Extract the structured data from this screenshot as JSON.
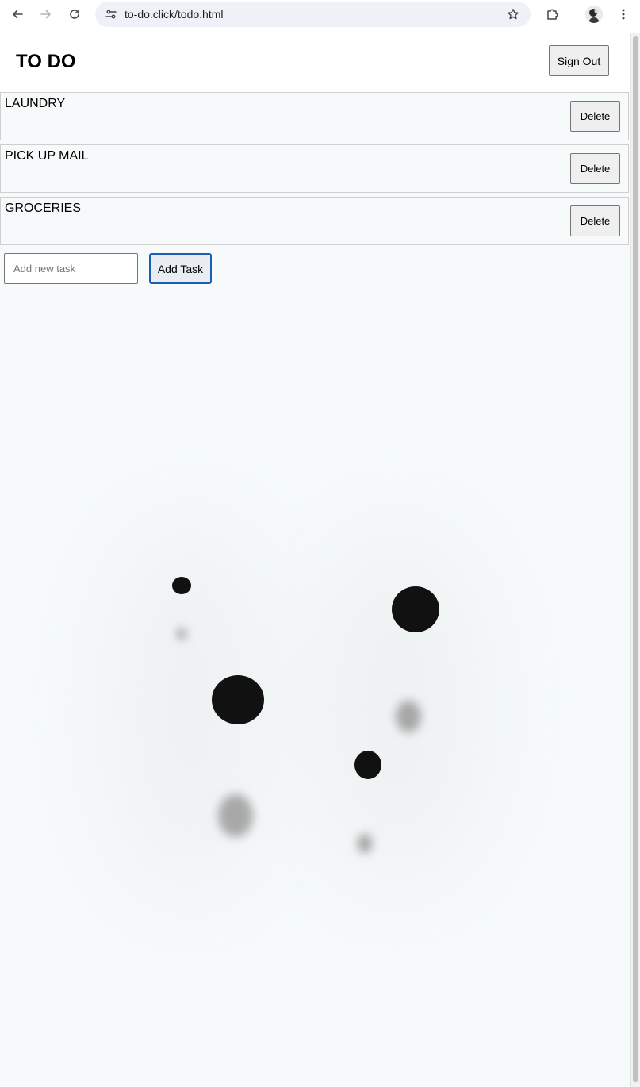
{
  "browser": {
    "url": "to-do.click/todo.html",
    "icons": {
      "back": "arrow-left-icon",
      "forward": "arrow-right-icon",
      "reload": "reload-icon",
      "site_info": "tune-icon",
      "bookmark": "star-icon",
      "extensions": "puzzle-icon",
      "profile": "avatar",
      "menu": "kebab-menu-icon"
    }
  },
  "app": {
    "title": "TO DO",
    "sign_out_label": "Sign Out",
    "tasks": [
      {
        "text": "LAUNDRY",
        "delete_label": "Delete"
      },
      {
        "text": "PICK UP MAIL",
        "delete_label": "Delete"
      },
      {
        "text": "GROCERIES",
        "delete_label": "Delete"
      }
    ],
    "new_task": {
      "placeholder": "Add new task",
      "value": ""
    },
    "add_task_label": "Add Task"
  },
  "colors": {
    "page_background": "#f6fafa",
    "button_background": "#efefef",
    "focus_ring": "#1a5fb4",
    "task_border": "#cfcfcf"
  }
}
